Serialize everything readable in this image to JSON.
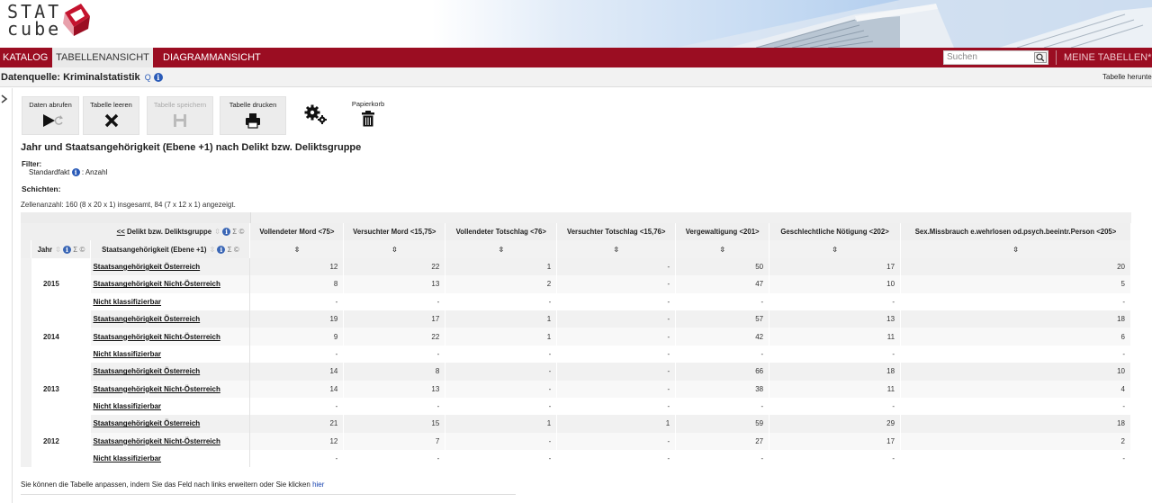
{
  "brand": {
    "line1": "STAT",
    "line2": "cube"
  },
  "nav": {
    "tabs": [
      {
        "label": "KATALOG",
        "active": false
      },
      {
        "label": "TABELLENANSICHT",
        "active": true
      },
      {
        "label": "DIAGRAMMANSICHT",
        "active": false
      }
    ],
    "search_placeholder": "Suchen",
    "my_tables": "MEINE TABELLEN*"
  },
  "datasource": {
    "label": "Datenquelle: Kriminalstatistik",
    "q": "Q",
    "right": "Tabelle herunte"
  },
  "toolbar": {
    "fetch": "Daten abrufen",
    "clear": "Tabelle leeren",
    "save": "Tabelle speichern",
    "print": "Tabelle drucken",
    "trash": "Papierkorb"
  },
  "table_meta": {
    "title": "Jahr und Staatsangehörigkeit (Ebene +1) nach Delikt bzw. Deliktsgruppe",
    "filter_heading": "Filter:",
    "filter_value_prefix": "Standardfakt",
    "filter_value_suffix": ": Anzahl",
    "layers": "Schichten:",
    "cells_prefix": "Zellenanzahl: 160 (",
    "cells_link1": "8 x 20 x 1",
    "cells_mid": ") insgesamt, 84 (",
    "cells_link2": "7 x 12 x 1",
    "cells_suffix": ") angezeigt."
  },
  "grid": {
    "col_dim_back": "<<",
    "col_dim_label": "Delikt bzw. Deliktsgruppe",
    "row_dim_year": "Jahr",
    "row_dim_nat": "Staatsangehörigkeit (Ebene +1)",
    "sort_glyph": "⇳",
    "columns": [
      "Vollendeter Mord <75>",
      "Versuchter Mord <15,75>",
      "Vollendeter Totschlag <76>",
      "Versuchter Totschlag <15,76>",
      "Vergewaltigung <201>",
      "Geschlechtliche Nötigung <202>",
      "Sex.Missbrauch e.wehrlosen od.psych.beeintr.Person <205>"
    ],
    "groups": [
      {
        "year": "2015",
        "rows": [
          {
            "label": "Staatsangehörigkeit Österreich",
            "values": [
              "12",
              "22",
              "1",
              "-",
              "50",
              "17",
              "20"
            ]
          },
          {
            "label": "Staatsangehörigkeit Nicht-Österreich",
            "values": [
              "8",
              "13",
              "2",
              "-",
              "47",
              "10",
              "5"
            ]
          },
          {
            "label": "Nicht klassifizierbar",
            "values": [
              "-",
              "-",
              "-",
              "-",
              "-",
              "-",
              "-"
            ]
          }
        ]
      },
      {
        "year": "2014",
        "rows": [
          {
            "label": "Staatsangehörigkeit Österreich",
            "values": [
              "19",
              "17",
              "1",
              "-",
              "57",
              "13",
              "18"
            ]
          },
          {
            "label": "Staatsangehörigkeit Nicht-Österreich",
            "values": [
              "9",
              "22",
              "1",
              "-",
              "42",
              "11",
              "6"
            ]
          },
          {
            "label": "Nicht klassifizierbar",
            "values": [
              "-",
              "-",
              "-",
              "-",
              "-",
              "-",
              "-"
            ]
          }
        ]
      },
      {
        "year": "2013",
        "rows": [
          {
            "label": "Staatsangehörigkeit Österreich",
            "values": [
              "14",
              "8",
              "-",
              "-",
              "66",
              "18",
              "10"
            ]
          },
          {
            "label": "Staatsangehörigkeit Nicht-Österreich",
            "values": [
              "14",
              "13",
              "-",
              "-",
              "38",
              "11",
              "4"
            ]
          },
          {
            "label": "Nicht klassifizierbar",
            "values": [
              "-",
              "-",
              "-",
              "-",
              "-",
              "-",
              "-"
            ]
          }
        ]
      },
      {
        "year": "2012",
        "rows": [
          {
            "label": "Staatsangehörigkeit Österreich",
            "values": [
              "21",
              "15",
              "1",
              "1",
              "59",
              "29",
              "18"
            ]
          },
          {
            "label": "Staatsangehörigkeit Nicht-Österreich",
            "values": [
              "12",
              "7",
              "-",
              "-",
              "27",
              "17",
              "2"
            ]
          },
          {
            "label": "Nicht klassifizierbar",
            "values": [
              "-",
              "-",
              "-",
              "-",
              "-",
              "-",
              "-"
            ]
          }
        ]
      }
    ]
  },
  "footer": {
    "note": "Sie können die Tabelle anpassen, indem Sie das Feld nach links erweitern oder Sie klicken",
    "link": "hier"
  },
  "colors": {
    "nav_bg": "#9b0d22",
    "active_tab_bg": "#e9e9e9",
    "info_blue": "#2a5bb8"
  }
}
